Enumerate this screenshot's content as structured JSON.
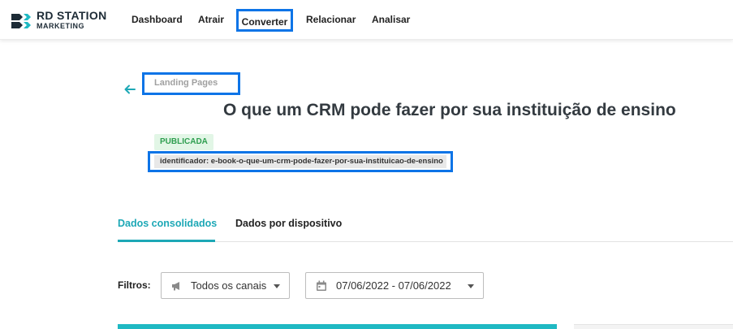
{
  "header": {
    "logo_line1": "RD STATION",
    "logo_line2": "MARKETING",
    "nav": [
      {
        "label": "Dashboard"
      },
      {
        "label": "Atrair"
      },
      {
        "label": "Converter"
      },
      {
        "label": "Relacionar"
      },
      {
        "label": "Analisar"
      }
    ]
  },
  "page": {
    "breadcrumb": "Landing Pages",
    "title": "O que um CRM pode fazer por sua instituição de ensino",
    "status": "PUBLICADA",
    "identifier": "identificador: e-book-o-que-um-crm-pode-fazer-por-sua-instituicao-de-ensino"
  },
  "tabs": [
    {
      "label": "Dados consolidados",
      "active": true
    },
    {
      "label": "Dados por dispositivo",
      "active": false
    }
  ],
  "filters": {
    "label": "Filtros:",
    "channels": {
      "value": "Todos os canais",
      "icon": "megaphone-icon"
    },
    "dates": {
      "value": "07/06/2022 - 07/06/2022",
      "icon": "calendar-icon"
    }
  },
  "colors": {
    "accent": "#1da8b6",
    "highlight_border": "#0d74e7",
    "status_bg": "#e2f6e6",
    "status_text": "#2e9e4f"
  }
}
